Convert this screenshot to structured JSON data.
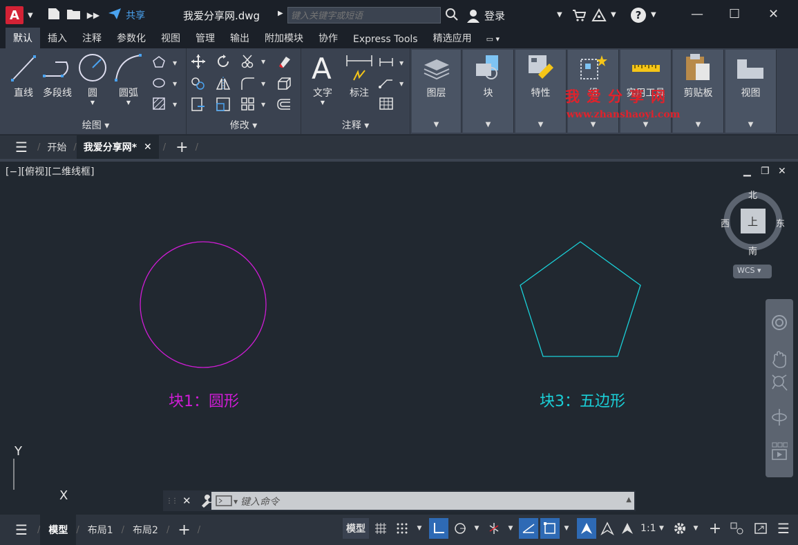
{
  "titlebar": {
    "app_letter": "A",
    "share_label": "共享",
    "file_title": "我爱分享网.dwg",
    "search_placeholder": "键入关键字或短语",
    "login_label": "登录",
    "help_label": "?"
  },
  "menu_tabs": [
    "默认",
    "插入",
    "注释",
    "参数化",
    "视图",
    "管理",
    "输出",
    "附加模块",
    "协作",
    "Express Tools",
    "精选应用"
  ],
  "ribbon": {
    "draw_tools": [
      "直线",
      "多段线",
      "圆",
      "圆弧"
    ],
    "draw_panel": "绘图",
    "modify_panel": "修改",
    "annot_tools": [
      "文字",
      "标注"
    ],
    "annot_panel": "注释",
    "tiles": [
      "图层",
      "块",
      "特性",
      "组",
      "实用工具",
      "剪贴板",
      "视图"
    ]
  },
  "watermark": {
    "title": "我爱分享网",
    "url": "www.zhanshaoyi.com"
  },
  "file_tabs": {
    "start": "开始",
    "active": "我爱分享网*"
  },
  "viewport": {
    "label": "[−][俯视][二维线框]",
    "compass": {
      "n": "北",
      "s": "南",
      "e": "东",
      "w": "西",
      "center": "上"
    },
    "wcs": "WCS",
    "axis_y": "Y",
    "axis_x": "X"
  },
  "drawing": {
    "circle_color": "#d01cd6",
    "pentagon_color": "#1ad0d8",
    "block1_label": "块1：圆形",
    "block3_label": "块3：五边形"
  },
  "command": {
    "placeholder": "键入命令"
  },
  "status": {
    "layout_tabs": [
      "模型",
      "布局1",
      "布局2"
    ],
    "model_button": "模型",
    "scale": "1:1"
  }
}
